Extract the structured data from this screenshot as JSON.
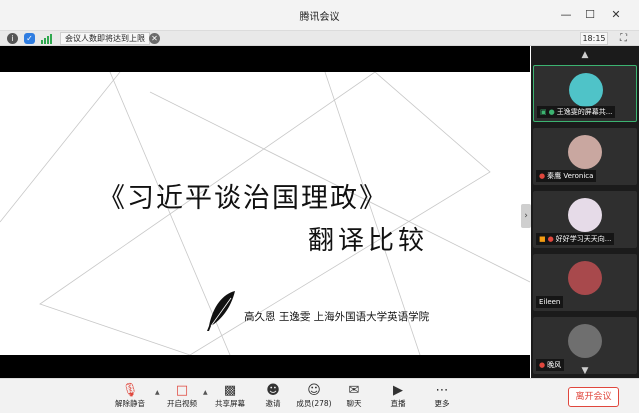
{
  "window": {
    "title": "腾讯会议",
    "minimize_icon": "minimize-icon",
    "maximize_icon": "maximize-icon",
    "close_icon": "close-icon"
  },
  "infobar": {
    "info_icon": "info-icon",
    "shield_icon": "shield-icon",
    "signal_icon": "signal-icon",
    "notice": "会议人数即将达到上限",
    "timer": "18:15"
  },
  "slide": {
    "title": "《习近平谈治国理政》",
    "subtitle": "翻译比较",
    "authors": "高久恩 王逸雯 上海外国语大学英语学院"
  },
  "participants": [
    {
      "name": "王逸雯的屏幕共...",
      "avatar_color": "#4fc3c8",
      "active": true
    },
    {
      "name": "秦鹰 Veronica",
      "avatar_color": "#c9a7a0",
      "active": false
    },
    {
      "name": "好好学习天天向...",
      "avatar_color": "#e6dbe8",
      "active": false
    },
    {
      "name": "Eileen",
      "avatar_color": "#a8494c",
      "active": false
    },
    {
      "name": "晚风",
      "avatar_color": "#6f6f6f",
      "active": false
    }
  ],
  "toolbar": {
    "mute_label": "解除静音",
    "video_label": "开启视频",
    "share_label": "共享屏幕",
    "invite_label": "邀请",
    "members_label": "成员(278)",
    "chat_label": "聊天",
    "live_label": "直播",
    "more_label": "更多",
    "leave_label": "离开会议"
  },
  "colors": {
    "accent_green": "#3cb371",
    "leave_red": "#e0473d",
    "mic_muted_red": "#e0473d"
  }
}
